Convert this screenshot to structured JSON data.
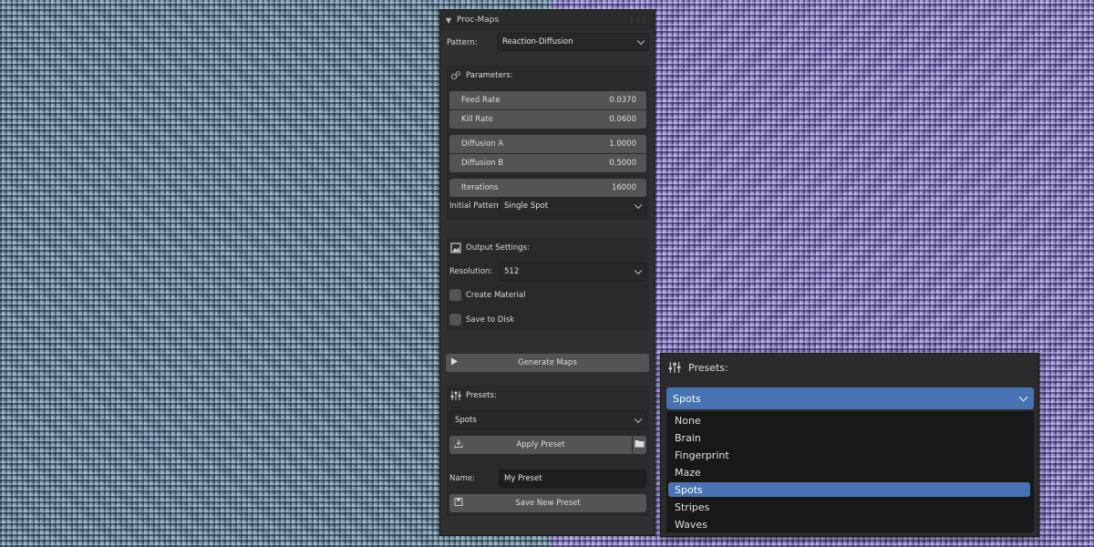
{
  "panel": {
    "title": "Proc-Maps",
    "pattern_label": "Pattern:",
    "pattern_value": "Reaction-Diffusion",
    "parameters": {
      "title": "Parameters:",
      "feed_rate_label": "Feed Rate",
      "feed_rate_value": "0.0370",
      "kill_rate_label": "Kill Rate",
      "kill_rate_value": "0.0600",
      "diffusion_a_label": "Diffusion A",
      "diffusion_a_value": "1.0000",
      "diffusion_b_label": "Diffusion B",
      "diffusion_b_value": "0.5000",
      "iterations_label": "Iterations",
      "iterations_value": "16000",
      "initial_pattern_label": "Initial Pattern:",
      "initial_pattern_value": "Single Spot"
    },
    "output": {
      "title": "Output Settings:",
      "resolution_label": "Resolution:",
      "resolution_value": "512",
      "create_material_label": "Create Material",
      "save_to_disk_label": "Save to Disk"
    },
    "generate_label": "Generate Maps",
    "presets": {
      "title": "Presets:",
      "selected": "Spots",
      "apply_label": "Apply Preset",
      "name_label": "Name:",
      "name_value": "My Preset",
      "save_label": "Save New Preset"
    }
  },
  "popup": {
    "title": "Presets:",
    "selected": "Spots",
    "options": [
      "None",
      "Brain",
      "Fingerprint",
      "Maze",
      "Spots",
      "Stripes",
      "Waves"
    ],
    "selected_index": 4
  },
  "colors": {
    "accent": "#4772b3",
    "panel_bg": "#303030",
    "field_bg": "#545454",
    "left_texture": "#6f8fa3",
    "right_texture": "#8a80c2"
  }
}
